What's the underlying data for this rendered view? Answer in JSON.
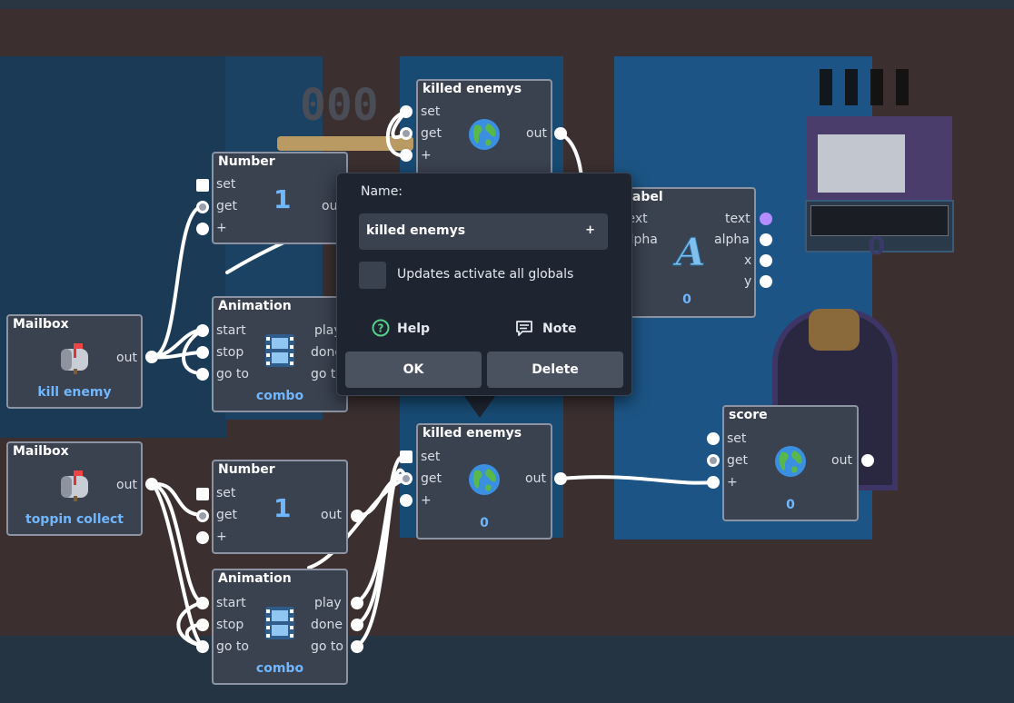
{
  "nodes": {
    "number_top": {
      "title": "Number",
      "value": "1",
      "ports_in": [
        "set",
        "get",
        "+"
      ],
      "port_out": "out"
    },
    "animation_top": {
      "title": "Animation",
      "value": "combo",
      "ports_in": [
        "start",
        "stop",
        "go to"
      ],
      "ports_out": [
        "play",
        "done",
        "go to"
      ]
    },
    "mailbox_kill": {
      "title": "Mailbox",
      "value": "kill enemy",
      "port_out": "out"
    },
    "killed_top": {
      "title": "killed enemys",
      "ports_in": [
        "set",
        "get",
        "+"
      ],
      "port_out": "out"
    },
    "label": {
      "title": "Label",
      "value": "0",
      "ports_in": [
        "text",
        "alpha"
      ],
      "ports_out": [
        "text",
        "alpha",
        "x",
        "y"
      ]
    },
    "mailbox_toppin": {
      "title": "Mailbox",
      "value": "toppin collect",
      "port_out": "out"
    },
    "number_bottom": {
      "title": "Number",
      "value": "1",
      "ports_in": [
        "set",
        "get",
        "+"
      ],
      "port_out": "out"
    },
    "killed_bottom": {
      "title": "killed enemys",
      "value": "0",
      "ports_in": [
        "set",
        "get",
        "+"
      ],
      "port_out": "out"
    },
    "score": {
      "title": "score",
      "value": "0",
      "ports_in": [
        "set",
        "get",
        "+"
      ],
      "port_out": "out"
    },
    "animation_bottom": {
      "title": "Animation",
      "value": "combo",
      "ports_in": [
        "start",
        "stop",
        "go to"
      ],
      "ports_out": [
        "play",
        "done",
        "go to"
      ]
    }
  },
  "popup": {
    "name_label": "Name:",
    "name_value": "killed enemys",
    "plus": "+",
    "checkbox_label": "Updates activate all globals",
    "help_label": "Help",
    "note_label": "Note",
    "ok_label": "OK",
    "delete_label": "Delete"
  },
  "game_overlay": {
    "counter_text": "000",
    "small_counter": "0"
  },
  "colors": {
    "node_bg": "#3a414f",
    "node_border": "#8c93a3",
    "value_text": "#6fb7ff",
    "popup_bg": "#1e2530",
    "button_bg": "#4a5260",
    "help_icon": "#55d08a"
  },
  "icons": {
    "mailbox": "mailbox-icon",
    "globe": "globe-icon",
    "film": "film-icon",
    "text_a": "text-letter-icon",
    "help": "help-circle-icon",
    "note": "note-icon"
  }
}
